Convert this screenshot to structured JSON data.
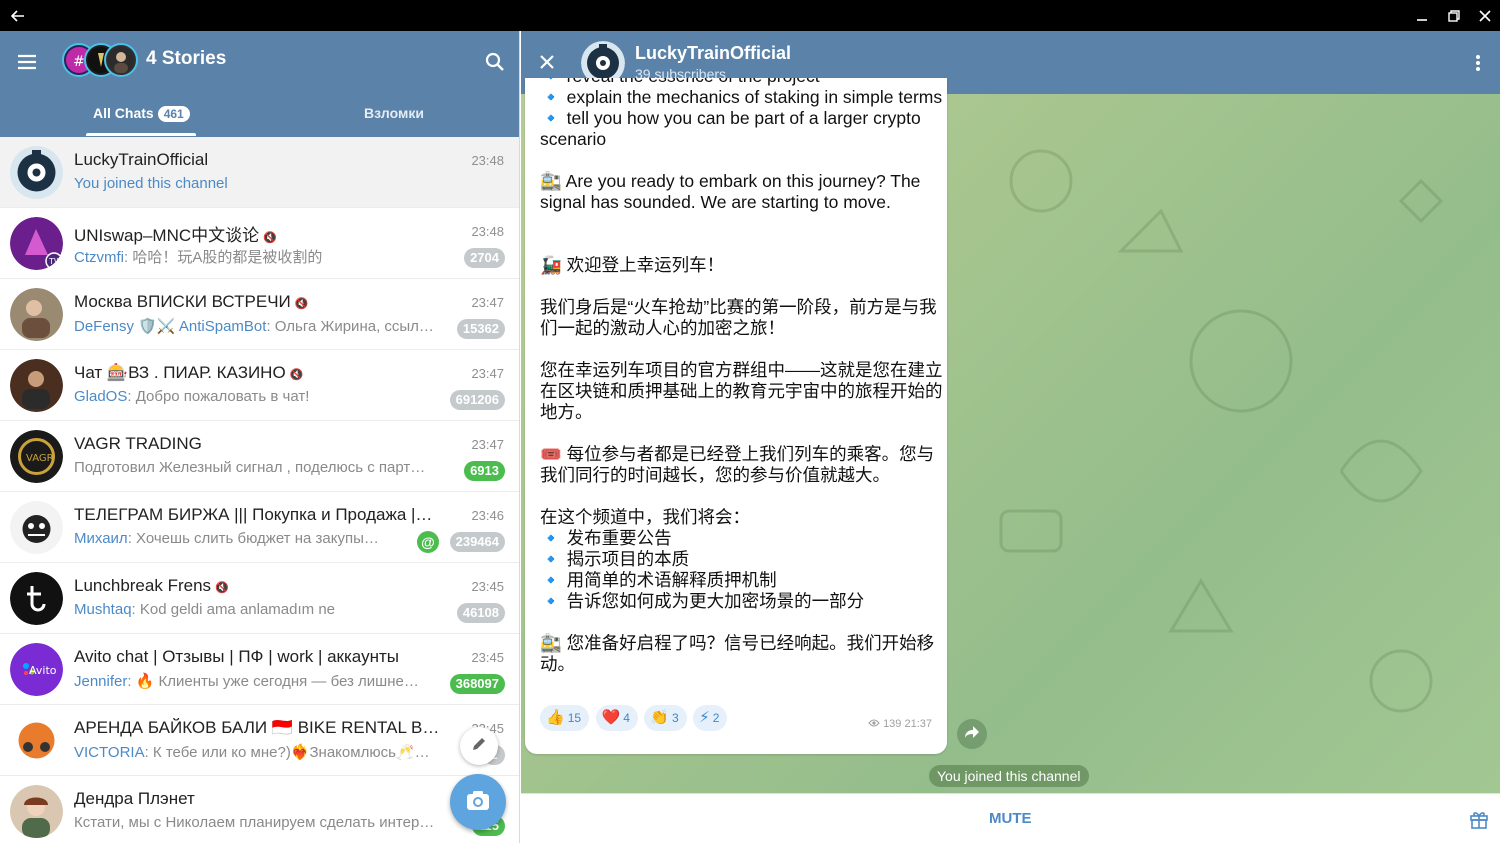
{
  "window": {
    "back_label": "←"
  },
  "left_header": {
    "stories_label": "4 Stories",
    "tabs": [
      {
        "label": "All Chats",
        "badge": "461"
      },
      {
        "label": "Взломки"
      }
    ]
  },
  "chats": [
    {
      "name": "LuckyTrainOfficial",
      "time": "23:48",
      "sender": "",
      "preview": "You joined this channel",
      "badge": "",
      "muted": false
    },
    {
      "name": "UNIswap–MNC中文谈论",
      "time": "23:48",
      "sender": "Ctzvmfi",
      "preview": ": 哈哈！玩A股的都是被收割的",
      "badge": "2704",
      "muted": true
    },
    {
      "name": "Москва ВПИСКИ ВСТРЕЧИ",
      "time": "23:47",
      "sender": "DeFensy 🛡️⚔️ AntiSpamBot",
      "preview": ": Ольга Жирина, ссыл…",
      "badge": "15362",
      "muted": true
    },
    {
      "name": "Чат 🎰ВЗ . ПИАР. КАЗИНО",
      "time": "23:47",
      "sender": "GladOS",
      "preview": ": Добро пожаловать в чат!",
      "badge": "691206",
      "muted": true
    },
    {
      "name": "VAGR TRADING",
      "time": "23:47",
      "sender": "",
      "preview": "Подготовил Железный сигнал , поделюсь с парт…",
      "badge": "6913",
      "muted": false
    },
    {
      "name": "ТЕЛЕГРАМ БИРЖА ||| Покупка и Продажа |…",
      "time": "23:46",
      "sender": "Михаил",
      "preview": ": Хочешь слить бюджет на закупы…",
      "badge": "239464",
      "muted": true,
      "mention": "@"
    },
    {
      "name": "Lunchbreak Frens",
      "time": "23:45",
      "sender": "Mushtaq",
      "preview": ": Kod geldi ama anlamadım ne",
      "badge": "46108",
      "muted": true
    },
    {
      "name": "Avito chat | Отзывы | ПФ | work | аккаунты",
      "time": "23:45",
      "sender": "Jennifer",
      "preview": ": 🔥 Клиенты уже сегодня — без лишне…",
      "badge": "368097",
      "muted": false
    },
    {
      "name": "АРЕНДА БАЙКОВ БАЛИ 🇮🇩 BIKE RENTAL B…",
      "time": "23:45",
      "sender": "VICTORIA",
      "preview": ": К тебе или ко мне?)❤️‍🔥Знакомлюсь🥂…",
      "badge": "2",
      "muted": true
    },
    {
      "name": "Дендра Плэнет",
      "time": "",
      "sender": "",
      "preview": "Кстати, мы с Николаем планируем сделать интер…",
      "badge": "115",
      "muted": false
    }
  ],
  "channel": {
    "title": "LuckyTrainOfficial",
    "subtitle": "39 subscribers",
    "message_lines": [
      "🔹 reveal the essence of the project",
      "🔹 explain the mechanics of staking in simple terms",
      "🔹 tell you how you can be part of a larger crypto scenario",
      "",
      "🚉 Are you ready to embark on this journey? The signal has sounded. We are starting to move.",
      "",
      "",
      "🚂 欢迎登上幸运列车！",
      "",
      "我们身后是“火车抢劫”比赛的第一阶段，前方是与我们一起的激动人心的加密之旅！",
      "",
      "您在幸运列车项目的官方群组中——这就是您在建立在区块链和质押基础上的教育元宇宙中的旅程开始的地方。",
      "",
      "🎟️ 每位参与者都是已经登上我们列车的乘客。您与我们同行的时间越长，您的参与价值就越大。",
      "",
      "在这个频道中，我们将会：",
      "🔹 发布重要公告",
      "🔹 揭示项目的本质",
      "🔹 用简单的术语解释质押机制",
      "🔹 告诉您如何成为更大加密场景的一部分",
      "",
      "🚉 您准备好启程了吗？信号已经响起。我们开始移动。"
    ],
    "reactions": [
      {
        "emoji": "👍",
        "count": "15"
      },
      {
        "emoji": "❤️",
        "count": "4"
      },
      {
        "emoji": "👏",
        "count": "3"
      },
      {
        "emoji": "⚡",
        "count": "2"
      }
    ],
    "views": "139",
    "time": "21:37",
    "service_message": "You joined this channel",
    "mute_label": "MUTE"
  },
  "colors": {
    "header": "#5b82a8",
    "accent": "#4c8ac7",
    "badge_green": "#4cbc4e",
    "badge_grey": "#c4c9cc",
    "fab": "#5ea4de"
  },
  "icons": [
    "back-arrow-icon",
    "minimize-icon",
    "restore-icon",
    "close-window-icon",
    "hamburger-menu-icon",
    "search-icon",
    "close-icon",
    "kebab-menu-icon",
    "pencil-icon",
    "camera-icon",
    "share-icon",
    "gift-icon",
    "eye-icon",
    "mute-bell-icon"
  ]
}
